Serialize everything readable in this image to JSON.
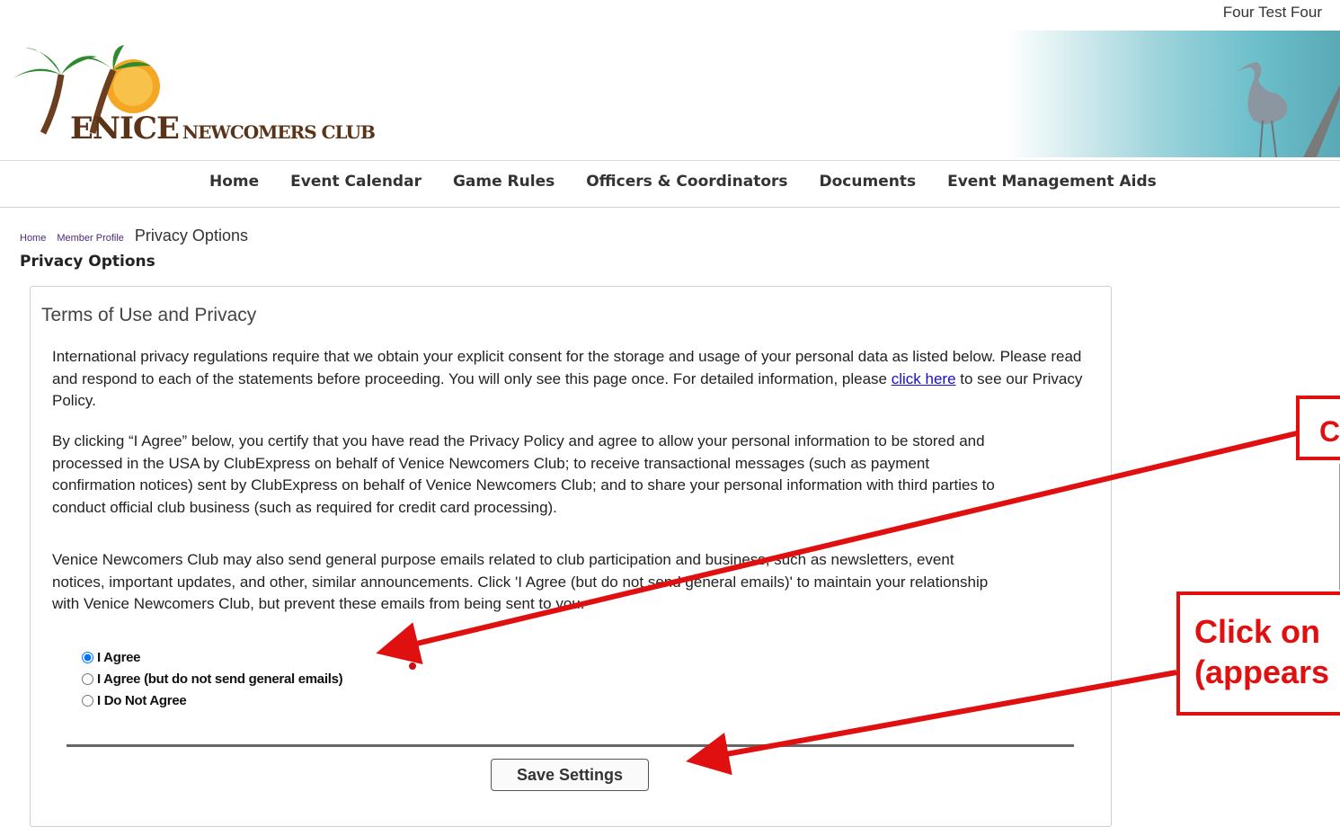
{
  "header": {
    "user_name": "Four Test Four",
    "logo_text_main": "ENICE",
    "logo_text_sub": "NEWCOMERS CLUB"
  },
  "nav": {
    "items": [
      "Home",
      "Event Calendar",
      "Game Rules",
      "Officers & Coordinators",
      "Documents",
      "Event Management Aids"
    ]
  },
  "breadcrumb": {
    "home": "Home",
    "member_profile": "Member Profile",
    "current": "Privacy Options"
  },
  "page": {
    "title": "Privacy Options"
  },
  "panel": {
    "title": "Terms of Use and Privacy",
    "para1_before_link": "International privacy regulations require that we obtain your explicit consent for the storage and usage of your personal data as listed below. Please read and respond to each of the statements before proceeding. You will only see this page once. For detailed information, please ",
    "para1_link": "click here",
    "para1_after_link": " to see our Privacy Policy.",
    "para2": "By clicking “I Agree” below, you certify that you have read the Privacy Policy and agree to allow your personal information to be stored and processed in the USA by ClubExpress on behalf of Venice Newcomers Club; to receive transactional messages (such as payment confirmation notices) sent by ClubExpress on behalf of Venice Newcomers Club; and to share your personal information with third parties to conduct official club business (such as required for credit card processing).",
    "para3": "Venice Newcomers Club may also send general purpose emails related to club participation and business, such as newsletters, event notices, important updates, and other, similar announcements. Click 'I Agree (but do not send general emails)' to maintain your relationship with Venice Newcomers Club, but prevent these emails from being sent to you.",
    "options": [
      {
        "label": "I Agree",
        "selected": true
      },
      {
        "label": "I Agree (but do not send general emails)",
        "selected": false
      },
      {
        "label": "I Do Not Agree",
        "selected": false
      }
    ],
    "save_label": "Save Settings"
  },
  "annotations": {
    "callout1": "C",
    "callout2_line1": "Click on",
    "callout2_line2": "(appears",
    "color": "#e01010"
  }
}
